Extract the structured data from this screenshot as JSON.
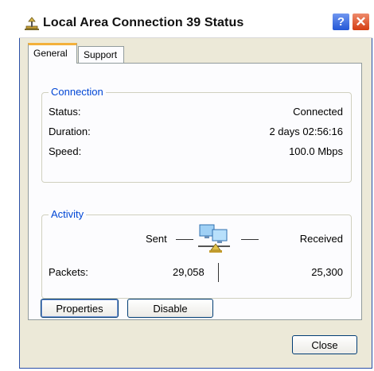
{
  "window": {
    "title": "Local Area Connection 39 Status",
    "help_label": "?",
    "close_label": "✕"
  },
  "tabs": [
    {
      "label": "General",
      "active": true
    },
    {
      "label": "Support",
      "active": false
    }
  ],
  "connection": {
    "group_label": "Connection",
    "rows": [
      {
        "label": "Status:",
        "value": "Connected"
      },
      {
        "label": "Duration:",
        "value": "2 days 02:56:16"
      },
      {
        "label": "Speed:",
        "value": "100.0 Mbps"
      }
    ]
  },
  "activity": {
    "group_label": "Activity",
    "sent_label": "Sent",
    "received_label": "Received",
    "packets_label": "Packets:",
    "packets_sent": "29,058",
    "packets_received": "25,300",
    "icon": "network-activity-icon"
  },
  "buttons": {
    "properties_label": "Properties",
    "disable_label": "Disable",
    "close_label": "Close"
  },
  "colors": {
    "group_label": "#0046d5",
    "active_tab_accent": "#f3b13b",
    "window_bg": "#ece9d8"
  }
}
